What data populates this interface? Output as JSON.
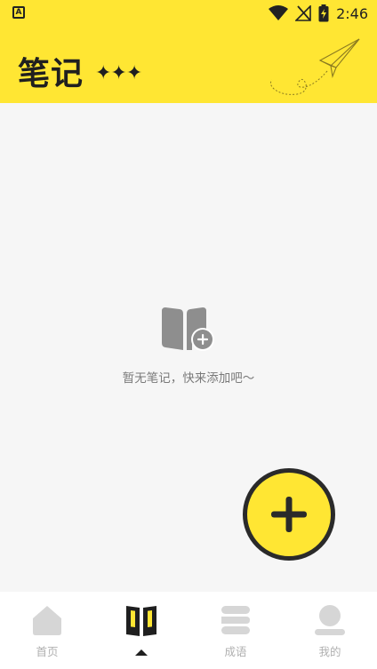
{
  "status_bar": {
    "notification_icon": "a-letter-icon",
    "notification_letter": "A",
    "wifi_icon": "wifi-icon",
    "signal_icon": "no-signal-icon",
    "battery_icon": "battery-charging-icon",
    "time": "2:46"
  },
  "header": {
    "title": "笔记",
    "decoration": "✦✦✦",
    "background_color": "#ffe633",
    "illustration_icon": "paper-plane-icon"
  },
  "empty_state": {
    "icon": "add-notebook-icon",
    "message": "暂无笔记，快来添加吧～"
  },
  "fab": {
    "icon": "plus-icon",
    "color": "#ffe633"
  },
  "bottom_nav": {
    "items": [
      {
        "id": "home",
        "label": "首页",
        "icon": "home-icon",
        "active": false
      },
      {
        "id": "notes",
        "label": "",
        "icon": "notes-icon",
        "active": true
      },
      {
        "id": "idioms",
        "label": "成语",
        "icon": "idiom-icon",
        "active": false
      },
      {
        "id": "me",
        "label": "我的",
        "icon": "profile-icon",
        "active": false
      }
    ]
  }
}
